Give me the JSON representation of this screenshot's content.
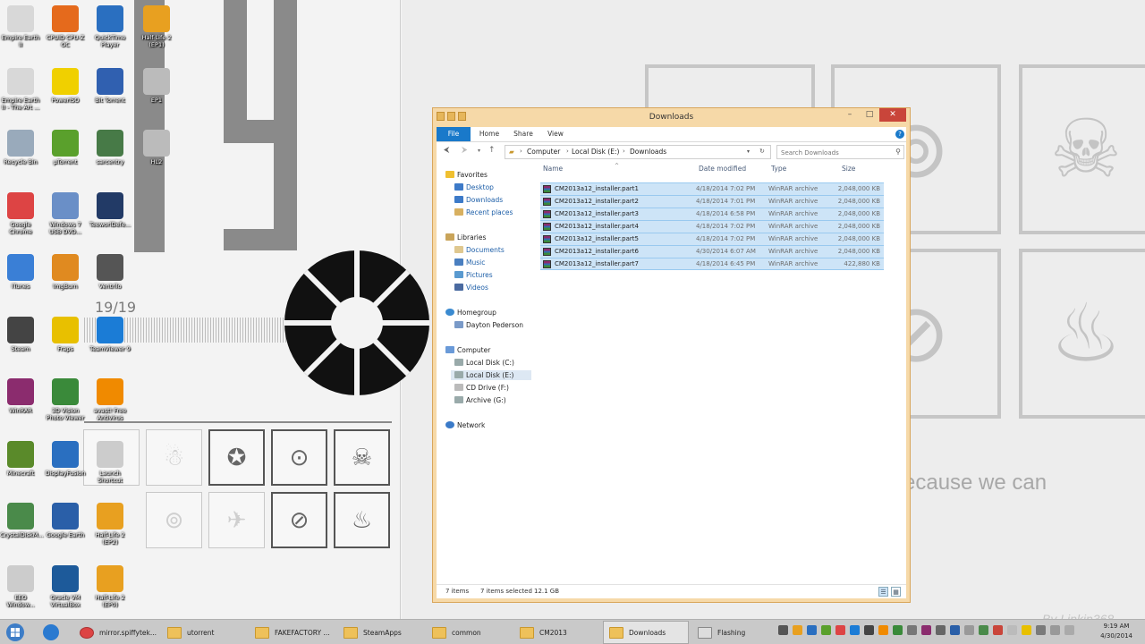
{
  "desktop": {
    "wallpaper": {
      "countdown_label": "19/19",
      "tagline": "ecause we can",
      "credit": "By Linkin368"
    },
    "icons": [
      {
        "label": "Empire Earth II",
        "color": "#d8d8d8"
      },
      {
        "label": "CPUID CPU-Z OC",
        "color": "#e56a1c"
      },
      {
        "label": "QuickTime Player",
        "color": "#2a6fc0"
      },
      {
        "label": "Half-Life 2 (EP1)",
        "color": "#e8a020"
      },
      {
        "label": "Empire Earth II - The Art ...",
        "color": "#d8d8d8"
      },
      {
        "label": "PowerISO",
        "color": "#f0d000"
      },
      {
        "label": "Bit Torrent",
        "color": "#3060b0"
      },
      {
        "label": "EP1",
        "color": "#bbbbbb"
      },
      {
        "label": "Recycle Bin",
        "color": "#9ab"
      },
      {
        "label": "µTorrent",
        "color": "#5aa02c"
      },
      {
        "label": "sarcentry",
        "color": "#477a47"
      },
      {
        "label": "HL2",
        "color": "#bbbbbb"
      },
      {
        "label": "Google Chrome",
        "color": "#d44"
      },
      {
        "label": "Windows 7 USB DVD...",
        "color": "#6a8fc7"
      },
      {
        "label": "TeeworlDefe...",
        "color": "#223a66"
      },
      {
        "label": "iTunes",
        "color": "#3a7fd6"
      },
      {
        "label": "ImgBurn",
        "color": "#e08a20"
      },
      {
        "label": "Ventrilo",
        "color": "#555"
      },
      {
        "label": "Steam",
        "color": "#444"
      },
      {
        "label": "Fraps",
        "color": "#e8c000"
      },
      {
        "label": "TeamViewer 9",
        "color": "#1b7cd6"
      },
      {
        "label": "WinRAR",
        "color": "#8b2c6e"
      },
      {
        "label": "3D Vision Photo Viewer",
        "color": "#3a8a3a"
      },
      {
        "label": "avast! Free Antivirus",
        "color": "#f08a00"
      },
      {
        "label": "Minecraft",
        "color": "#5a8a2a"
      },
      {
        "label": "DisplayFusion",
        "color": "#2a6fc0"
      },
      {
        "label": "Launch Shortcut",
        "color": "#cccccc"
      },
      {
        "label": "CrystalDiskM...",
        "color": "#4a8a4a"
      },
      {
        "label": "Google Earth",
        "color": "#2a5fa8"
      },
      {
        "label": "Half-Life 2 (EP2)",
        "color": "#e8a020"
      },
      {
        "label": "EEO Window...",
        "color": "#cccccc"
      },
      {
        "label": "Oracle VM VirtualBox",
        "color": "#1d5a9a"
      },
      {
        "label": "Half-Life 2 (EP0)",
        "color": "#e8a020"
      }
    ]
  },
  "explorer": {
    "title": "Downloads",
    "window_buttons": {
      "minimize": "–",
      "maximize": "□",
      "close": "✕"
    },
    "ribbon_tabs": [
      "File",
      "Home",
      "Share",
      "View"
    ],
    "help": "?",
    "breadcrumb": [
      "Computer",
      "Local Disk (E:)",
      "Downloads"
    ],
    "search_placeholder": "Search Downloads",
    "nav": {
      "favorites": {
        "label": "Favorites",
        "items": [
          "Desktop",
          "Downloads",
          "Recent places"
        ]
      },
      "libraries": {
        "label": "Libraries",
        "items": [
          "Documents",
          "Music",
          "Pictures",
          "Videos"
        ]
      },
      "homegroup": {
        "label": "Homegroup",
        "items": [
          "Dayton Pederson"
        ]
      },
      "computer": {
        "label": "Computer",
        "items": [
          "Local Disk (C:)",
          "Local Disk (E:)",
          "CD Drive (F:)",
          "Archive (G:)"
        ]
      },
      "network": {
        "label": "Network"
      }
    },
    "columns": {
      "name": "Name",
      "date": "Date modified",
      "type": "Type",
      "size": "Size"
    },
    "files": [
      {
        "name": "CM2013a12_installer.part1",
        "date": "4/18/2014 7:02 PM",
        "type": "WinRAR archive",
        "size": "2,048,000 KB"
      },
      {
        "name": "CM2013a12_installer.part2",
        "date": "4/18/2014 7:01 PM",
        "type": "WinRAR archive",
        "size": "2,048,000 KB"
      },
      {
        "name": "CM2013a12_installer.part3",
        "date": "4/18/2014 6:58 PM",
        "type": "WinRAR archive",
        "size": "2,048,000 KB"
      },
      {
        "name": "CM2013a12_installer.part4",
        "date": "4/18/2014 7:02 PM",
        "type": "WinRAR archive",
        "size": "2,048,000 KB"
      },
      {
        "name": "CM2013a12_installer.part5",
        "date": "4/18/2014 7:02 PM",
        "type": "WinRAR archive",
        "size": "2,048,000 KB"
      },
      {
        "name": "CM2013a12_installer.part6",
        "date": "4/30/2014 6:07 AM",
        "type": "WinRAR archive",
        "size": "2,048,000 KB"
      },
      {
        "name": "CM2013a12_installer.part7",
        "date": "4/18/2014 6:45 PM",
        "type": "WinRAR archive",
        "size": "422,880 KB"
      }
    ],
    "status": {
      "count": "7 items",
      "selected": "7 items selected",
      "size": "12.1 GB"
    }
  },
  "taskbar": {
    "buttons": [
      {
        "label": "mirror.spiffytek...",
        "kind": "chrome"
      },
      {
        "label": "utorrent",
        "kind": "folder"
      },
      {
        "label": "FAKEFACTORY ...",
        "kind": "folder"
      },
      {
        "label": "SteamApps",
        "kind": "folder"
      },
      {
        "label": "common",
        "kind": "folder"
      },
      {
        "label": "CM2013",
        "kind": "folder"
      },
      {
        "label": "Downloads",
        "kind": "folder",
        "active": true
      },
      {
        "label": "Flashing",
        "kind": "app"
      }
    ],
    "clock": {
      "time": "9:19 AM",
      "date": "4/30/2014"
    }
  }
}
